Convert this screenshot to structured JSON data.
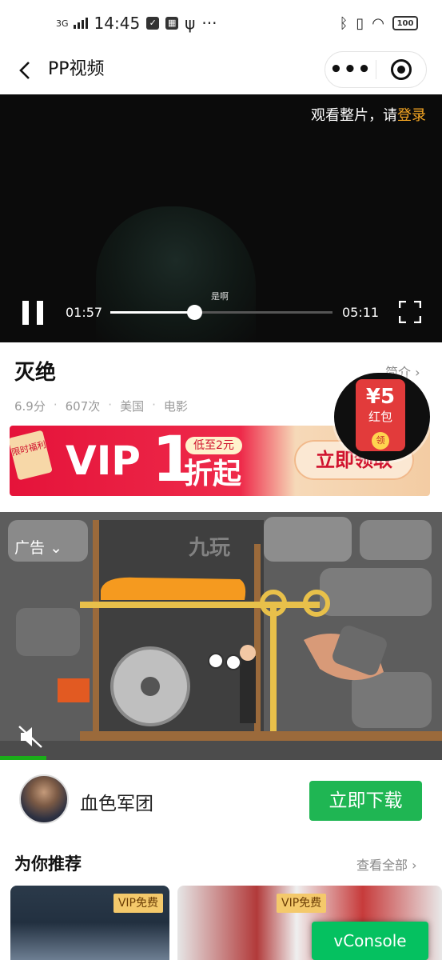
{
  "status_bar": {
    "network": "3G",
    "time": "14:45",
    "battery": "100"
  },
  "nav": {
    "title": "PP视频",
    "more": "•••"
  },
  "video": {
    "login_prompt": "观看整片，请",
    "login_link": "登录",
    "subtitle": "是啊",
    "current_time": "01:57",
    "total_time": "05:11",
    "progress_fraction": 0.376
  },
  "info": {
    "title": "灭绝",
    "intro_link": "简介",
    "score": "6.9分",
    "plays": "607次",
    "region": "美国",
    "category": "电影",
    "dot": "·"
  },
  "red_packet": {
    "amount": "¥5",
    "label": "红包",
    "action": "领"
  },
  "vip_banner": {
    "tag": "限时福利",
    "vip": "VIP",
    "number": "1",
    "low": "低至2元",
    "zhe": "折起",
    "button": "立即领取"
  },
  "ad": {
    "label": "广告",
    "brand": "九玩"
  },
  "app": {
    "name": "血色军团",
    "download": "立即下载"
  },
  "recommend": {
    "title": "为你推荐",
    "view_all": "查看全部",
    "badge": "VIP免费"
  },
  "vconsole": "vConsole",
  "colors": {
    "accent_green": "#1fb653",
    "login_orange": "#f5a623",
    "vip_red": "#e5133a"
  }
}
